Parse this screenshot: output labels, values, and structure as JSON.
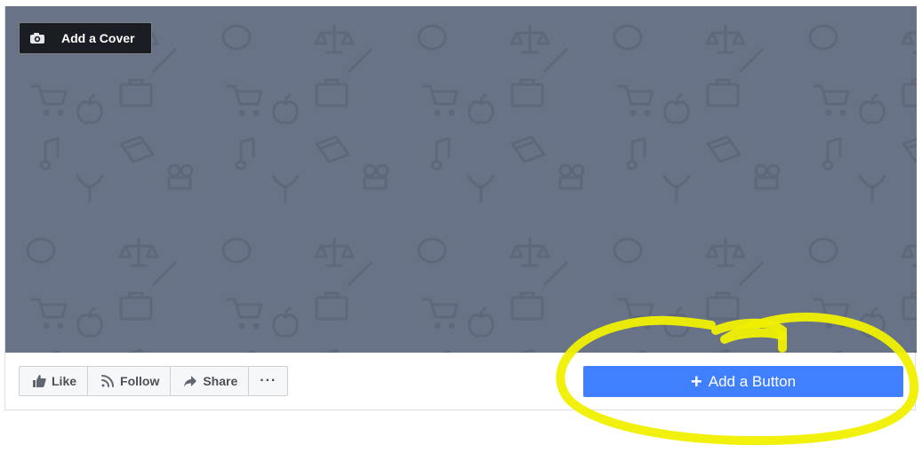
{
  "cover": {
    "add_cover_label": "Add a Cover",
    "background_color": "#687387",
    "pattern_icons": [
      "paintbrush-icon",
      "shopping-cart-icon",
      "column-icon",
      "briefcase-icon",
      "book-icon",
      "film-camera-icon",
      "music-note-icon",
      "tree-icon",
      "palette-icon",
      "scales-icon",
      "apple-icon"
    ]
  },
  "actions": {
    "like_label": "Like",
    "follow_label": "Follow",
    "share_label": "Share",
    "more_label": "···"
  },
  "cta": {
    "plus": "+",
    "label": "Add a Button",
    "color": "#4080ff"
  },
  "annotation": {
    "highlight_color": "#f0f000"
  }
}
